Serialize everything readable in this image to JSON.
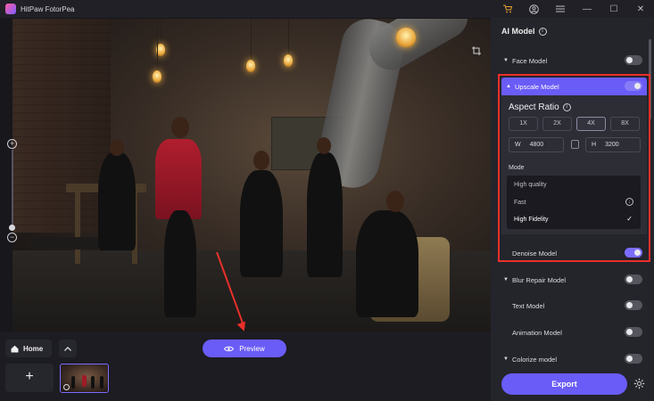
{
  "app": {
    "title": "HitPaw FotorPea"
  },
  "titlebar": {
    "cart_icon": "cart-icon",
    "account_icon": "account-icon",
    "menu_icon": "menu-icon",
    "minimize": "—",
    "maximize": "☐",
    "close": "✕"
  },
  "canvas": {
    "crop_icon": "crop-icon"
  },
  "bottom": {
    "home_label": "Home",
    "preview_label": "Preview",
    "add_label": "+",
    "up_label": "⌃"
  },
  "panel": {
    "title": "AI Model",
    "models": [
      {
        "label": "Face Model",
        "on": false,
        "expandable": true
      },
      {
        "label": "Upscale Model",
        "on": true,
        "expandable": true
      },
      {
        "label": "Denoise Model",
        "on": true,
        "expandable": false
      },
      {
        "label": "Blur Repair Model",
        "on": false,
        "expandable": true
      },
      {
        "label": "Text Model",
        "on": false,
        "expandable": false
      },
      {
        "label": "Animation Model",
        "on": false,
        "expandable": false
      },
      {
        "label": "Colorize model",
        "on": false,
        "expandable": true
      }
    ],
    "upscale": {
      "aspect_title": "Aspect Ratio",
      "scales": [
        "1X",
        "2X",
        "4X",
        "8X"
      ],
      "selected_scale": "4X",
      "width_label": "W",
      "width_value": "4800",
      "height_label": "H",
      "height_value": "3200",
      "mode_label": "Mode",
      "modes": [
        "High quality",
        "Fast",
        "High Fidelity"
      ],
      "selected_mode": "High Fidelity"
    },
    "export_label": "Export"
  },
  "colors": {
    "accent": "#6a5cf6",
    "highlight": "#e8302a",
    "panel_bg": "#24242b"
  }
}
